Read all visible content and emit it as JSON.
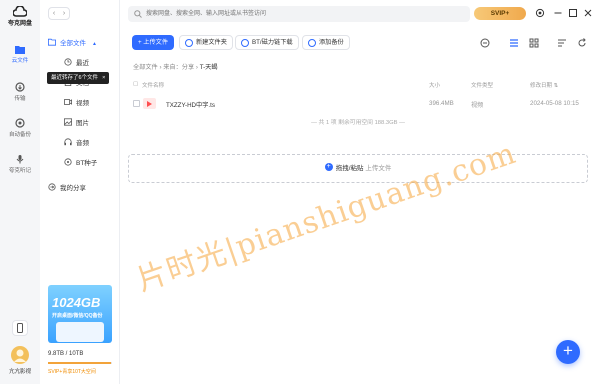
{
  "app": {
    "name": "夸克网盘"
  },
  "rail": {
    "items": [
      {
        "label": "云文件"
      },
      {
        "label": "传输"
      },
      {
        "label": "自动备份"
      },
      {
        "label": "夸克听记"
      }
    ],
    "user_name": "亢亢影视"
  },
  "tree": {
    "root_label": "全部文件",
    "tooltip": "最近转存了6个文件",
    "tooltip_close": "×",
    "items": [
      {
        "label": "最近"
      },
      {
        "label": "文档"
      },
      {
        "label": "视频"
      },
      {
        "label": "图片"
      },
      {
        "label": "音频"
      },
      {
        "label": "BT种子"
      }
    ],
    "share_label": "我的分享"
  },
  "promo": {
    "big": "1024GB",
    "small": "开启桌面/微信/QQ备份"
  },
  "storage": {
    "text": "9.8TB / 10TB",
    "used_fraction": 0.98,
    "svip_tip": "SVIP+青享10T大空间"
  },
  "search": {
    "placeholder": "搜索网盘、搜索全网、输入网址或从书签访问"
  },
  "svip": {
    "label": "SVIP+"
  },
  "toolbar": {
    "upload": "上传文件",
    "new_folder": "新建文件夹",
    "bt_download": "BT/磁力链下载",
    "add_backup": "添加备份"
  },
  "breadcrumb": {
    "parts": [
      "全部文件",
      "来自：分享"
    ],
    "current": "T-天蝎"
  },
  "table": {
    "headers": {
      "name": "文件名称",
      "size": "大小",
      "type": "文件类型",
      "modified": "修改日期"
    },
    "rows": [
      {
        "name": "TXZZY-HD中字.ts",
        "size": "396.4MB",
        "type": "视频",
        "modified": "2024-05-08 10:15"
      }
    ],
    "summary": "共 1 项 剩余可用空间 188.3GB"
  },
  "dropzone": {
    "label": "拖拽/粘贴",
    "hint": "上传文件"
  },
  "watermark": "片时光|pianshiguang.com",
  "fab": "+",
  "nav": {
    "back": "‹",
    "forward": "›"
  }
}
